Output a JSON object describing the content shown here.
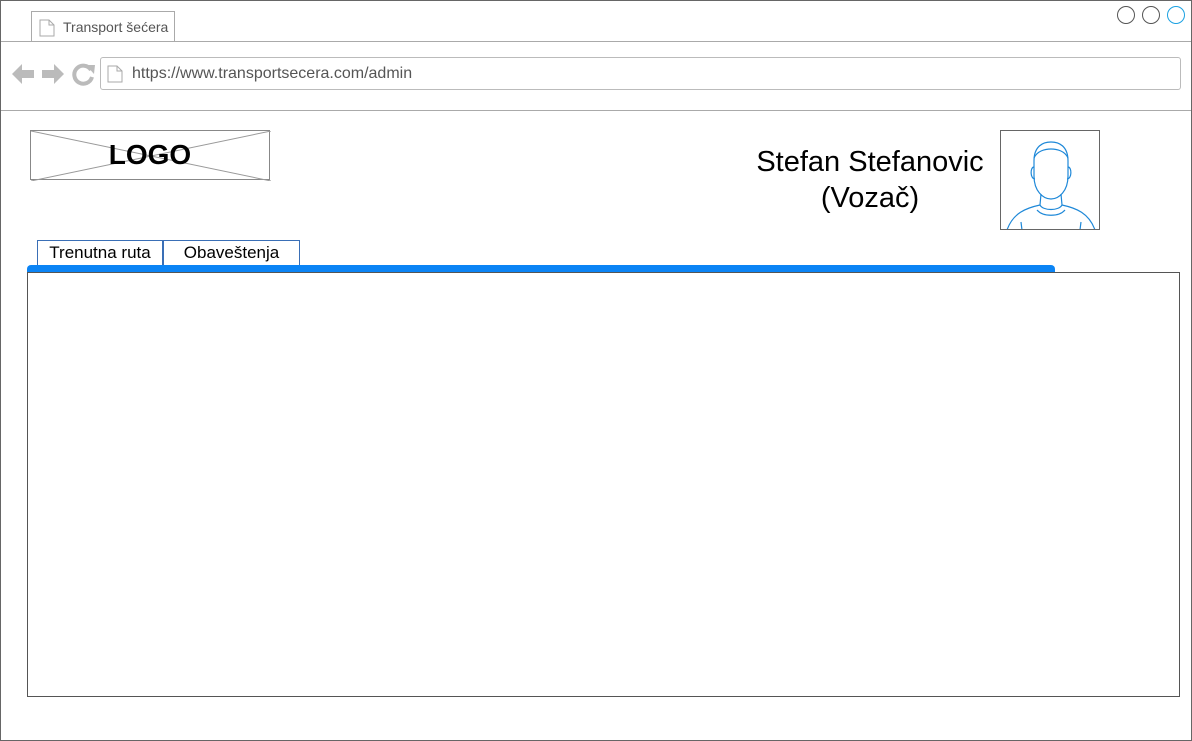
{
  "browser": {
    "tab_title": "Transport šećera",
    "url": "https://www.transportsecera.com/admin",
    "window_buttons": [
      "minimize",
      "maximize",
      "close"
    ],
    "active_button_color": "#1ba1e2"
  },
  "header": {
    "logo_text": "LOGO",
    "user": {
      "name": "Stefan Stefanovic",
      "role": "(Vozač)"
    }
  },
  "tabs": [
    {
      "label": "Trenutna ruta"
    },
    {
      "label": "Obaveštenja"
    }
  ],
  "colors": {
    "accent": "#0b84f5",
    "avatar_stroke": "#1e88d8"
  }
}
